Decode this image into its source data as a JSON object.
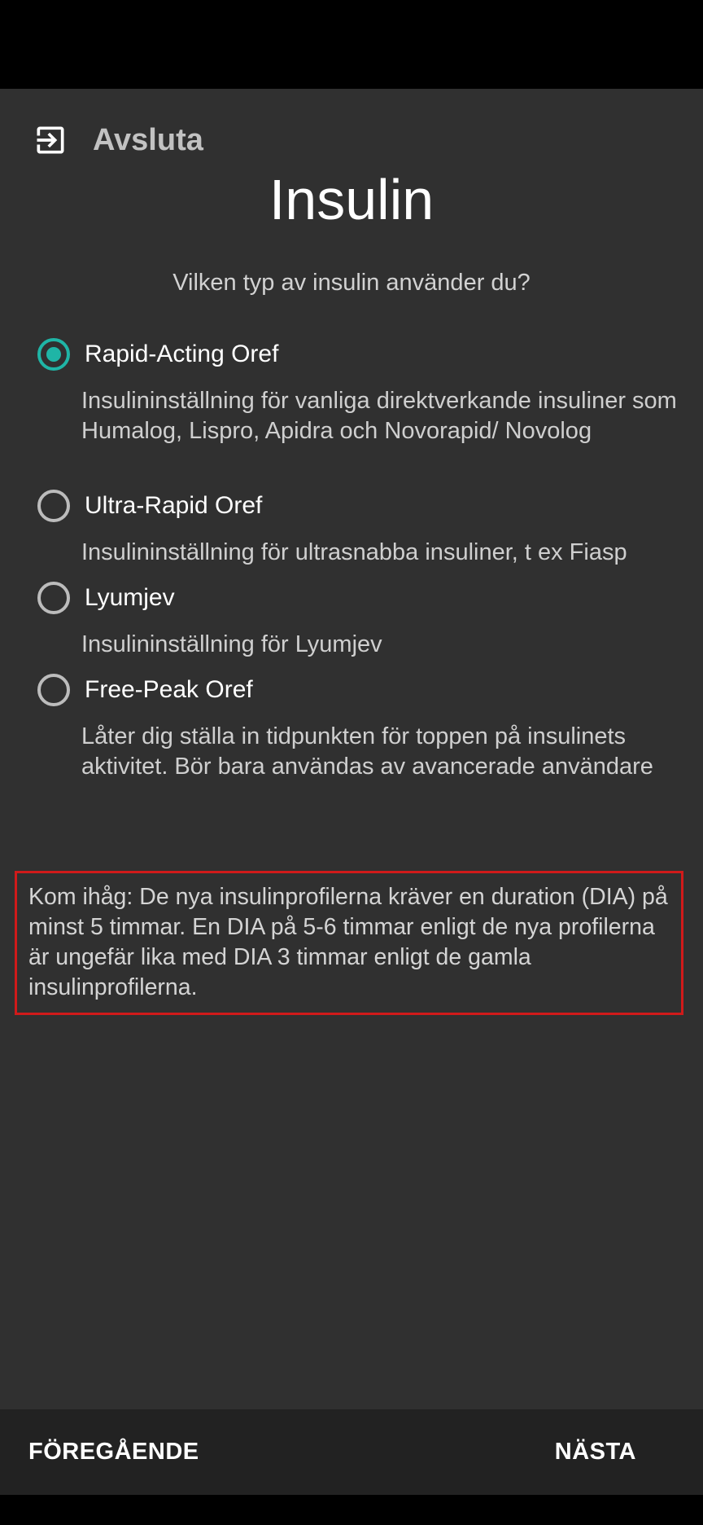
{
  "header": {
    "exit_label": "Avsluta",
    "exit_icon": "exit-icon"
  },
  "page": {
    "title": "Insulin",
    "question": "Vilken typ av insulin använder du?"
  },
  "options": [
    {
      "label": "Rapid-Acting Oref",
      "description": "Insulininställning för vanliga direktverkande insuliner som Humalog, Lispro, Apidra och Novorapid/ Novolog",
      "checked": true
    },
    {
      "label": "Ultra-Rapid Oref",
      "description": "Insulininställning för ultrasnabba insuliner, t ex Fiasp",
      "checked": false
    },
    {
      "label": "Lyumjev",
      "description": "Insulininställning för Lyumjev",
      "checked": false
    },
    {
      "label": "Free-Peak Oref",
      "description": "Låter dig ställa in tidpunkten för toppen på insulinets aktivitet. Bör bara användas av avancerade användare",
      "checked": false
    }
  ],
  "note": "Kom ihåg: De nya insulinprofilerna kräver en duration (DIA) på minst 5 timmar. En DIA på 5-6 timmar enligt de nya profilerna är ungefär lika med DIA 3 timmar enligt de gamla insulinprofilerna.",
  "footer": {
    "prev_label": "FÖREGÅENDE",
    "next_label": "NÄSTA"
  },
  "colors": {
    "accent": "#1fb5a6",
    "background": "#303030",
    "note_border": "#d01a1a"
  }
}
